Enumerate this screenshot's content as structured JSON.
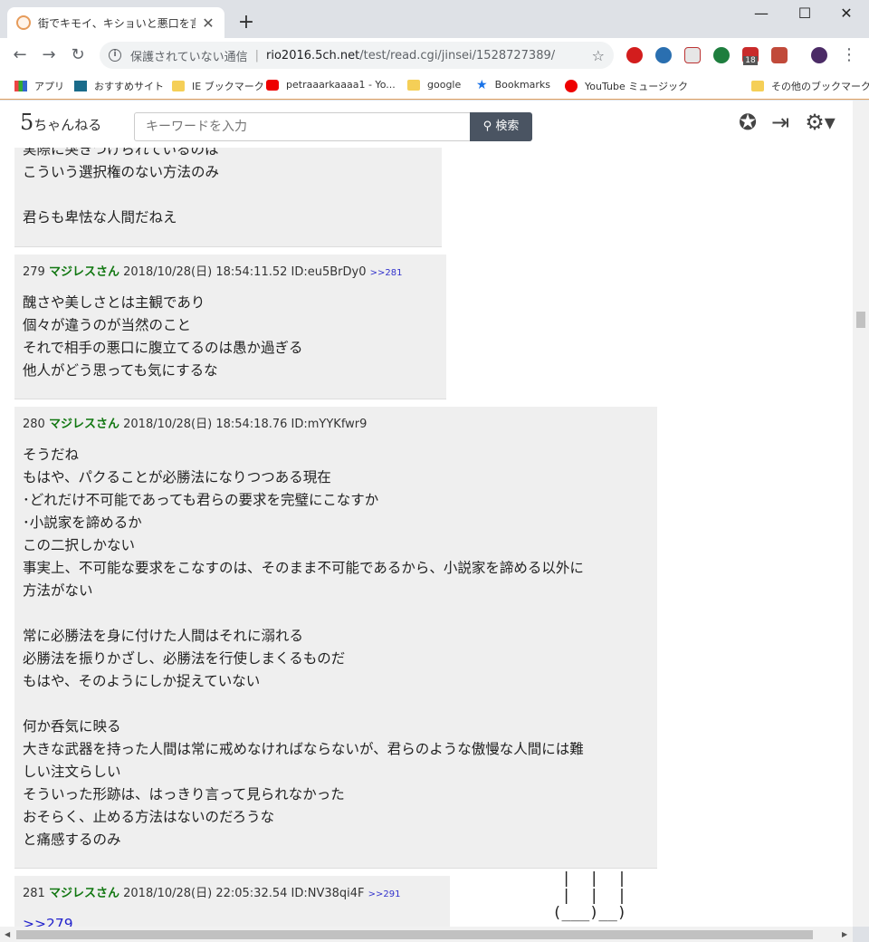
{
  "browser": {
    "tab_title": "街でキモイ、キショいと悪口を言われる",
    "tab_close": "✕",
    "new_tab": "+",
    "minimize": "—",
    "maximize": "☐",
    "close": "✕",
    "security_label": "保護されていない通信",
    "url_host": "rio2016.5ch.net",
    "url_path": "/test/read.cgi/jinsei/1528727389/",
    "ext_badge": "18"
  },
  "bookmarks": [
    {
      "label": "アプリ"
    },
    {
      "label": "おすすめサイト"
    },
    {
      "label": "IE ブックマーク"
    },
    {
      "label": "petraaarkaaaa1 - Yo..."
    },
    {
      "label": "google"
    },
    {
      "label": "Bookmarks"
    },
    {
      "label": "YouTube ミュージック"
    },
    {
      "label": "その他のブックマーク"
    }
  ],
  "site": {
    "logo": "5",
    "logo_sub": "ちゃんねる",
    "search_placeholder": "キーワードを入力",
    "search_button": "検索"
  },
  "posts": [
    {
      "body": "実際に突きつけられているのは\nこういう選択権のない方法のみ\n\n君らも卑怯な人間だねえ"
    },
    {
      "num": "279",
      "name": "マジレスさん",
      "date": "2018/10/28(日) 18:54:11.52",
      "id": "ID:eu5BrDy0",
      "reply": ">>281",
      "body": "醜さや美しさとは主観であり\n個々が違うのが当然のこと\nそれで相手の悪口に腹立てるのは愚か過ぎる\n他人がどう思っても気にするな"
    },
    {
      "num": "280",
      "name": "マジレスさん",
      "date": "2018/10/28(日) 18:54:18.76",
      "id": "ID:mYYKfwr9",
      "body": "そうだね\nもはや、パクることが必勝法になりつつある現在\n･どれだけ不可能であっても君らの要求を完璧にこなすか\n･小説家を諦めるか\nこの二択しかない\n事実上、不可能な要求をこなすのは、そのまま不可能であるから、小説家を諦める以外に\n方法がない\n\n常に必勝法を身に付けた人間はそれに溺れる\n必勝法を振りかざし、必勝法を行使しまくるものだ\nもはや、そのようにしか捉えていない\n\n何か呑気に映る\n大きな武器を持った人間は常に戒めなければならないが、君らのような傲慢な人間には難\nしい注文らしい\nそういった形跡は、はっきり言って見られなかった\nおそらく、止める方法はないのだろうな\nと痛感するのみ"
    },
    {
      "num": "281",
      "name": "マジレスさん",
      "date": "2018/10/28(日) 22:05:32.54",
      "id": "ID:NV38qi4F",
      "reply": ">>291",
      "anchor": ">>279"
    }
  ],
  "ascii_art": "  |  |  |\n  |  |  |\n (___)__)"
}
